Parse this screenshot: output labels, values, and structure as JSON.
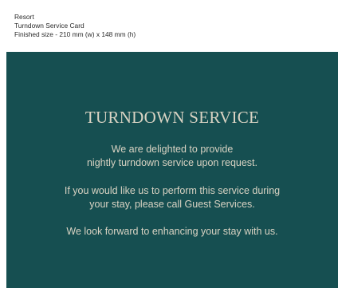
{
  "header": {
    "line1": "Resort",
    "line2": "Turndown Service Card",
    "line3": "Finished size - 210 mm (w) x 148 mm (h)"
  },
  "card": {
    "background_color": "#164f51",
    "text_color": "#d9d3c3",
    "title": "TURNDOWN SERVICE",
    "paragraph1": {
      "line1": "We are delighted to provide",
      "line2": "nightly turndown service upon request."
    },
    "paragraph2": {
      "line1": "If you would like us to perform this service during",
      "line2": "your stay, please call Guest Services."
    },
    "paragraph3": {
      "line1": "We look forward to enhancing your stay with us."
    }
  }
}
